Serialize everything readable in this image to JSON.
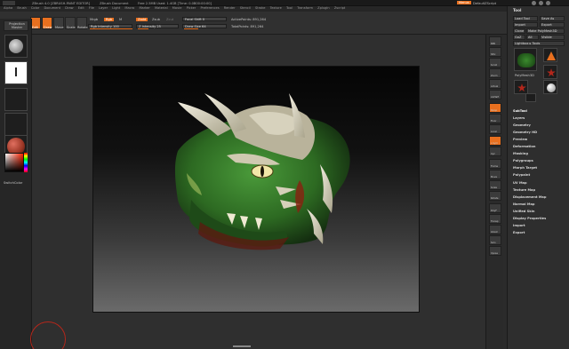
{
  "titlebar": {
    "app_left": "ZBrush 4.0 [ZBRUSH-PAINT EDITOR]",
    "doc_info": "ZBrush Document",
    "mem": "Free 2.5MB  Used: 1.4GB  [Time: 0.0B00:00:00]",
    "right_btn": "Menus",
    "default_script": "DefaultZScript",
    "help_icons": "?"
  },
  "menu": [
    "Alpha",
    "Brush",
    "Color",
    "Document",
    "Draw",
    "Edit",
    "File",
    "Layer",
    "Light",
    "Macro",
    "Marker",
    "Material",
    "Movie",
    "Picker",
    "Preferences",
    "Render",
    "Stencil",
    "Stroke",
    "Texture",
    "Tool",
    "Transform",
    "Zplugin",
    "Zscript"
  ],
  "shelf": {
    "buttons": [
      "Edit",
      "Draw",
      "Move",
      "Scale",
      "Rotate"
    ],
    "mrgb": "Mrgb",
    "rgb": "Rgb",
    "m": "M",
    "zadd": "Zadd",
    "zsub": "Zsub",
    "zcut": "Zcut",
    "rgb_intensity": "Rgb Intensity 100",
    "z_intensity": "Z Intensity 25",
    "focal_shift": "Focal Shift 0",
    "draw_size": "Draw Size 64",
    "active_points": "ActivePoints: 891,264",
    "total_points": "TotalPoints: 891,264"
  },
  "lefttray": {
    "projection_master": "Projection Master",
    "gradient": "Gradient",
    "switch_color": "SwitchColor",
    "alternate": "Alternate"
  },
  "tool": {
    "title": "Tool",
    "load_tool": "Load Tool",
    "save_as": "Save As",
    "import": "Import",
    "export": "Export",
    "clone": "Clone",
    "make_polymesh": "Make PolyMesh3D",
    "goz": "GoZ",
    "all": "All",
    "visible": "Visible",
    "lightbox_tools": "Lightbox ▸ Tools",
    "current_tool": "PolyMesh3D",
    "thumb_labels": [
      "PolyMesh3D",
      "SimpleBrush",
      "Sphere3D",
      "Cylinder3D"
    ],
    "items": [
      "SubTool",
      "Layers",
      "Geometry",
      "Geometry HD",
      "Preview",
      "Deformation",
      "Masking",
      "Polygroups",
      "Morph Target",
      "Polypaint",
      "UV Map",
      "Texture Map",
      "Displacement Map",
      "Normal Map",
      "Unified Skin",
      "Display Properties",
      "Import",
      "Export"
    ]
  },
  "rightshelf": [
    "BPR",
    "SPix",
    "Scroll",
    "Zoom",
    "Actual",
    "AAHalf",
    "Persp",
    "Floor",
    "Local",
    "L.Sym",
    "Xyz",
    "Frame",
    "Move",
    "Scale",
    "Rotate",
    "PolyF",
    "Transp",
    "Ghost",
    "Solo",
    "Xpose"
  ],
  "colors": {
    "accent": "#e9701f",
    "panel": "#2e2e2e",
    "background": "#2b2b2b"
  }
}
